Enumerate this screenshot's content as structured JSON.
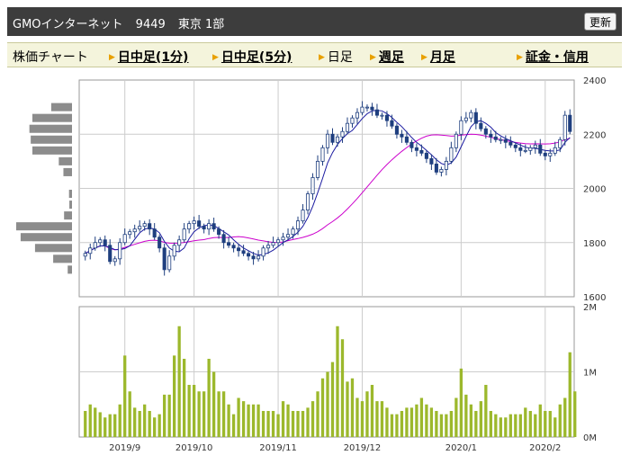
{
  "header": {
    "name": "GMOインターネット",
    "code": "9449",
    "market": "東京 1部",
    "refresh_label": "更新"
  },
  "nav": {
    "label": "株価チャート",
    "items": [
      {
        "label": "日中足(1分)",
        "link": true
      },
      {
        "label": "日中足(5分)",
        "link": true
      },
      {
        "label": "日足",
        "link": false
      },
      {
        "label": "週足",
        "link": true
      },
      {
        "label": "月足",
        "link": true
      },
      {
        "label": "証金・信用",
        "link": true
      }
    ]
  },
  "colors": {
    "up_candle": "#ffffff",
    "down_candle": "#1f3f7f",
    "ma_short": "#1a1aa0",
    "ma_long": "#cc00cc",
    "volume_bar": "#9cb82c",
    "volume_profile": "#8c8c8c"
  },
  "chart_data": [
    {
      "type": "candlestick",
      "y_ticks": [
        "1600",
        "1800",
        "2000",
        "2200",
        "2400"
      ],
      "ylim": [
        1600,
        2400
      ],
      "x_ticks": [
        "2019/9",
        "2019/10",
        "2019/11",
        "2019/12",
        "2020/1",
        "2020/2"
      ],
      "grid": true,
      "series": [
        {
          "close": [
            1760,
            1780,
            1800,
            1810,
            1790,
            1730,
            1740,
            1800,
            1830,
            1840,
            1850,
            1860,
            1870,
            1850,
            1820,
            1780,
            1700,
            1750,
            1790,
            1810,
            1850,
            1870,
            1880,
            1860,
            1850,
            1870,
            1850,
            1830,
            1800,
            1790,
            1780,
            1770,
            1760,
            1750,
            1740,
            1750,
            1780,
            1790,
            1800,
            1810,
            1820,
            1830,
            1850,
            1880,
            1920,
            1980,
            2040,
            2100,
            2150,
            2200,
            2170,
            2190,
            2210,
            2240,
            2260,
            2280,
            2300,
            2300,
            2290,
            2270,
            2270,
            2250,
            2230,
            2200,
            2190,
            2170,
            2150,
            2140,
            2130,
            2110,
            2090,
            2060,
            2070,
            2100,
            2150,
            2200,
            2250,
            2260,
            2280,
            2240,
            2220,
            2200,
            2190,
            2180,
            2180,
            2170,
            2160,
            2150,
            2140,
            2140,
            2150,
            2160,
            2130,
            2120,
            2130,
            2150,
            2180,
            2270,
            2210
          ]
        }
      ]
    },
    {
      "type": "bar",
      "y_ticks": [
        "2M",
        "1M",
        "0M"
      ],
      "ylim": [
        0,
        2000000
      ],
      "series": [
        {
          "name": "volume",
          "values": [
            400000,
            500000,
            450000,
            380000,
            300000,
            350000,
            350000,
            500000,
            1250000,
            700000,
            450000,
            400000,
            500000,
            400000,
            300000,
            350000,
            650000,
            650000,
            1250000,
            1700000,
            1200000,
            800000,
            800000,
            700000,
            700000,
            1200000,
            1000000,
            700000,
            700000,
            500000,
            350000,
            600000,
            550000,
            500000,
            500000,
            500000,
            400000,
            400000,
            400000,
            350000,
            550000,
            500000,
            400000,
            400000,
            400000,
            450000,
            550000,
            700000,
            900000,
            1000000,
            1150000,
            1700000,
            1500000,
            850000,
            900000,
            600000,
            550000,
            700000,
            800000,
            550000,
            550000,
            450000,
            350000,
            350000,
            400000,
            450000,
            450000,
            500000,
            600000,
            500000,
            450000,
            400000,
            350000,
            350000,
            400000,
            600000,
            1050000,
            650000,
            500000,
            400000,
            550000,
            800000,
            400000,
            350000,
            300000,
            300000,
            350000,
            350000,
            350000,
            450000,
            400000,
            350000,
            500000,
            400000,
            400000,
            300000,
            500000,
            600000,
            1300000,
            700000
          ]
        }
      ]
    }
  ]
}
